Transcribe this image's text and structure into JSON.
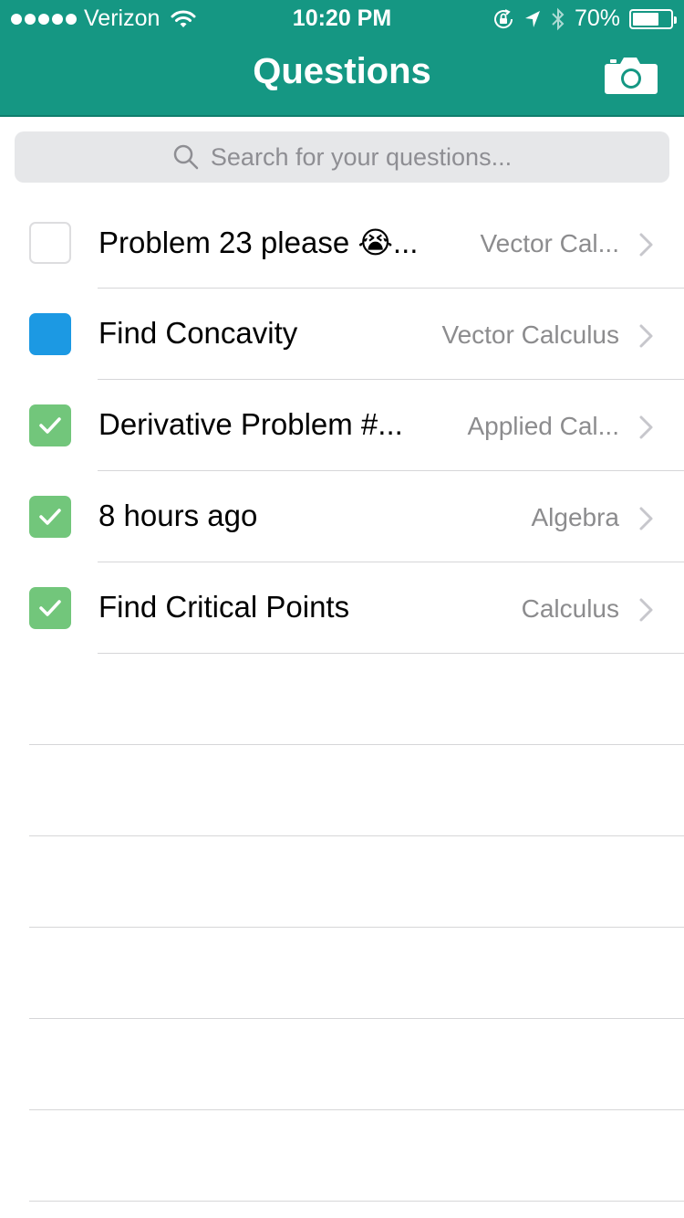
{
  "status_bar": {
    "carrier": "Verizon",
    "time": "10:20 PM",
    "battery_text": "70%",
    "battery_level": 0.7,
    "signal_bars": 5
  },
  "nav": {
    "title": "Questions",
    "camera_icon": "camera-icon"
  },
  "search": {
    "placeholder": "Search for your questions..."
  },
  "questions": [
    {
      "title": "Problem 23 please 😭...",
      "subject": "Vector Cal...",
      "status": "unchecked"
    },
    {
      "title": "Find Concavity",
      "subject": "Vector Calculus",
      "status": "pending"
    },
    {
      "title": "Derivative Problem #...",
      "subject": "Applied Cal...",
      "status": "checked"
    },
    {
      "title": "8 hours ago",
      "subject": "Algebra",
      "status": "checked"
    },
    {
      "title": "Find Critical Points",
      "subject": "Calculus",
      "status": "checked"
    }
  ],
  "colors": {
    "header": "#159783",
    "pending": "#1c99e3",
    "checked": "#72c67b"
  }
}
